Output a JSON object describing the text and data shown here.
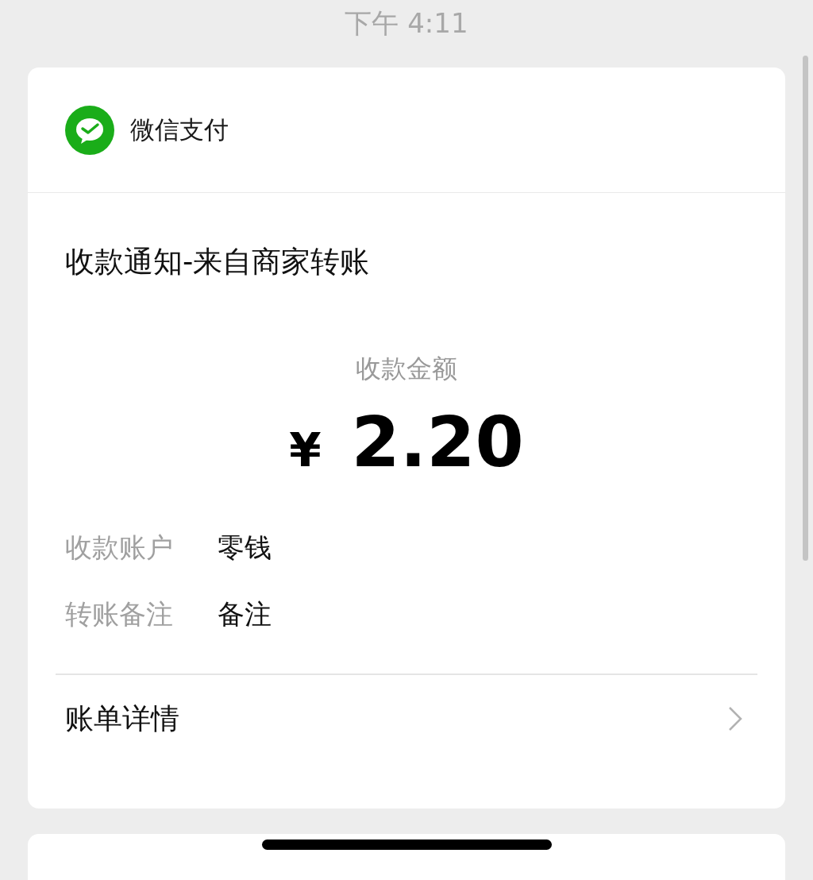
{
  "status_bar": {
    "time": "下午 4:11"
  },
  "header": {
    "app_name": "微信支付"
  },
  "notice": {
    "title": "收款通知-来自商家转账",
    "amount_label": "收款金额",
    "currency": "¥",
    "amount": "2.20",
    "fields": [
      {
        "label": "收款账户",
        "value": "零钱"
      },
      {
        "label": "转账备注",
        "value": "备注"
      }
    ],
    "link": "账单详情"
  }
}
